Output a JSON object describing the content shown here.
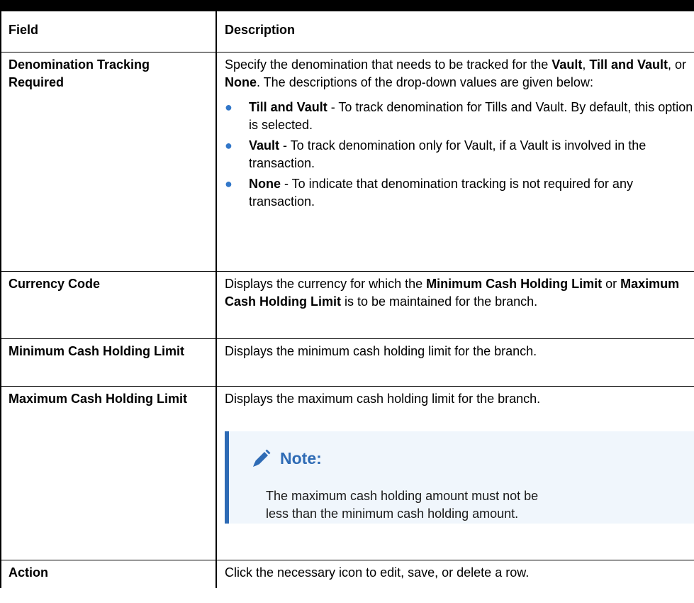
{
  "table": {
    "headers": [
      "Field",
      "Description"
    ],
    "rows": {
      "denomination": {
        "field": "Denomination Tracking Required",
        "desc_parts": [
          "Specify the denomination that needs to be tracked for the ",
          "Vault",
          ", ",
          "Till and Vault",
          ", or ",
          "None",
          ". The descriptions of the drop-down values are given below:"
        ],
        "options": [
          {
            "term": "Till and Vault",
            "text": " - To track denomination for Tills and Vault. By default, this option is selected."
          },
          {
            "term": "Vault",
            "text": " - To track denomination only for Vault, if a Vault is involved in the transaction."
          },
          {
            "term": "None",
            "text": " - To indicate that denomination tracking is not required for any transaction."
          }
        ]
      },
      "currency": {
        "field": "Currency Code",
        "desc_parts": [
          "Displays the currency for which the ",
          "Minimum Cash Holding Limit",
          " or ",
          "Maximum Cash Holding Limit",
          " is to be maintained for the branch."
        ]
      },
      "min_cash": {
        "field": "Minimum Cash Holding Limit",
        "desc": "Displays the minimum cash holding limit for the branch."
      },
      "max_cash": {
        "field": "Maximum Cash Holding Limit",
        "desc": "Displays the maximum cash holding limit for the branch.",
        "note": {
          "title": "Note:",
          "body": "The maximum cash holding amount must not be less than the minimum cash holding amount."
        }
      },
      "action": {
        "field": "Action",
        "desc": "Click the necessary icon to edit, save, or delete a row."
      }
    }
  },
  "colors": {
    "bullet": "#3277c9",
    "note_accent": "#2e6bb5",
    "note_bg": "#f0f6fc"
  },
  "icons": {
    "bullet": "bullet-dot-icon",
    "note": "pencil-icon"
  }
}
